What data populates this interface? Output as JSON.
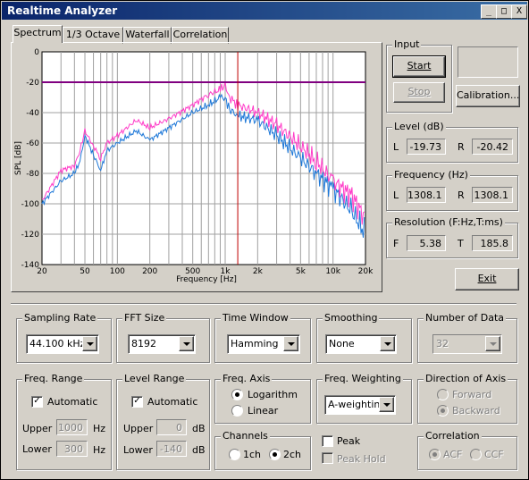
{
  "window": {
    "title": "Realtime Analyzer",
    "min": "_",
    "max": "□",
    "close": "X"
  },
  "tabs": [
    "Spectrum",
    "1/3 Octave",
    "Waterfall",
    "Correlation"
  ],
  "chart_data": {
    "type": "line",
    "title": "",
    "xlabel": "Frequency [Hz]",
    "ylabel": "SPL [dB]",
    "x_scale": "log",
    "xlim": [
      20,
      20000
    ],
    "ylim": [
      -140,
      0
    ],
    "x_ticks": [
      "20",
      "50",
      "100",
      "200",
      "500",
      "1k",
      "2k",
      "5k",
      "10k",
      "20k"
    ],
    "y_ticks": [
      "0",
      "-20",
      "-40",
      "-60",
      "-80",
      "-100",
      "-120",
      "-140"
    ],
    "grid": true,
    "series": [
      {
        "color": "#1e78d8",
        "x": [
          20,
          30,
          40,
          45,
          50,
          60,
          70,
          80,
          100,
          150,
          200,
          300,
          500,
          700,
          900,
          1000,
          1100,
          1308,
          2000,
          3000,
          5000,
          7000,
          10000,
          15000,
          20000
        ],
        "y": [
          -100,
          -85,
          -80,
          -72,
          -55,
          -68,
          -78,
          -65,
          -60,
          -52,
          -58,
          -50,
          -40,
          -35,
          -30,
          -30,
          -38,
          -42,
          -45,
          -55,
          -70,
          -80,
          -90,
          -105,
          -120
        ]
      },
      {
        "color": "#ff3cc8",
        "x": [
          20,
          30,
          40,
          45,
          50,
          60,
          70,
          80,
          100,
          150,
          200,
          300,
          500,
          700,
          900,
          1000,
          1100,
          1308,
          2000,
          3000,
          5000,
          7000,
          10000,
          15000,
          20000
        ],
        "y": [
          -98,
          -78,
          -75,
          -65,
          -52,
          -62,
          -70,
          -60,
          -55,
          -45,
          -50,
          -44,
          -35,
          -28,
          -25,
          -22,
          -30,
          -35,
          -40,
          -48,
          -62,
          -72,
          -85,
          -95,
          -110
        ]
      }
    ],
    "markers": {
      "level_db": -20,
      "frequency_hz": 1308.1,
      "level_color": "#800080",
      "frequency_color": "#c00000"
    }
  },
  "input": {
    "label": "Input",
    "start": "Start",
    "stop": "Stop",
    "calibration": "Calibration..."
  },
  "level": {
    "label": "Level (dB)",
    "l_label": "L",
    "r_label": "R",
    "l_value": "-19.73",
    "r_value": "-20.42"
  },
  "frequency": {
    "label": "Frequency (Hz)",
    "l_label": "L",
    "r_label": "R",
    "l_value": "1308.1",
    "r_value": "1308.1"
  },
  "resolution": {
    "label": "Resolution (F:Hz,T:ms)",
    "f_label": "F",
    "t_label": "T",
    "f_value": "5.38",
    "t_value": "185.8"
  },
  "exit": "Exit",
  "sampling_rate": {
    "label": "Sampling Rate",
    "value": "44.100 kHz"
  },
  "fft_size": {
    "label": "FFT Size",
    "value": "8192"
  },
  "time_window": {
    "label": "Time Window",
    "value": "Hamming"
  },
  "smoothing": {
    "label": "Smoothing",
    "value": "None"
  },
  "number_of_data": {
    "label": "Number of Data",
    "value": "32"
  },
  "freq_range": {
    "label": "Freq. Range",
    "automatic": "Automatic",
    "upper_label": "Upper",
    "lower_label": "Lower",
    "upper": "1000",
    "lower": "300",
    "unit": "Hz"
  },
  "level_range": {
    "label": "Level Range",
    "automatic": "Automatic",
    "upper_label": "Upper",
    "lower_label": "Lower",
    "upper": "0",
    "lower": "-140",
    "unit": "dB"
  },
  "freq_axis": {
    "label": "Freq. Axis",
    "logarithm": "Logarithm",
    "linear": "Linear"
  },
  "freq_weighting": {
    "label": "Freq. Weighting",
    "value": "A-weighting"
  },
  "direction": {
    "label": "Direction of Axis",
    "forward": "Forward",
    "backward": "Backward"
  },
  "channels": {
    "label": "Channels",
    "ch1": "1ch",
    "ch2": "2ch"
  },
  "peak": {
    "peak": "Peak",
    "peak_hold": "Peak Hold"
  },
  "correlation": {
    "label": "Correlation",
    "acf": "ACF",
    "ccf": "CCF"
  }
}
